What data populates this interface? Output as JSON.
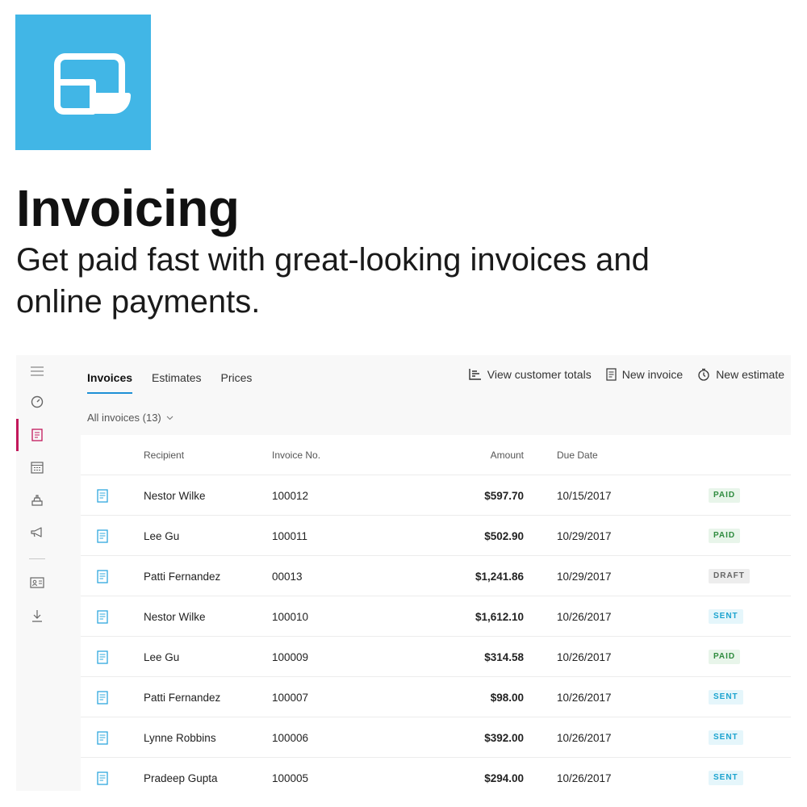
{
  "hero": {
    "title": "Invoicing",
    "subtitle": "Get paid fast with great-looking invoices and online payments."
  },
  "colors": {
    "brand_tile": "#41b6e6",
    "active_rail": "#c2185b",
    "active_tab_underline": "#1e90d6",
    "paid": "#2e8b3e",
    "sent": "#1ba3cf",
    "draft": "#666666"
  },
  "rail": {
    "items": [
      {
        "icon": "hamburger-menu-icon"
      },
      {
        "icon": "dashboard-gauge-icon"
      },
      {
        "icon": "invoice-document-icon",
        "active": true
      },
      {
        "icon": "calendar-icon"
      },
      {
        "icon": "cash-register-icon"
      },
      {
        "icon": "megaphone-icon"
      },
      {
        "icon": "contact-card-icon"
      },
      {
        "icon": "download-icon"
      }
    ]
  },
  "tabs": [
    {
      "label": "Invoices",
      "active": true
    },
    {
      "label": "Estimates",
      "active": false
    },
    {
      "label": "Prices",
      "active": false
    }
  ],
  "commands": {
    "view_totals": "View customer totals",
    "new_invoice": "New invoice",
    "new_estimate": "New estimate"
  },
  "filter": {
    "label": "All invoices (13)"
  },
  "table": {
    "headers": {
      "recipient": "Recipient",
      "number": "Invoice No.",
      "amount": "Amount",
      "due": "Due Date"
    },
    "rows": [
      {
        "recipient": "Nestor Wilke",
        "number": "100012",
        "amount": "$597.70",
        "due": "10/15/2017",
        "status": "PAID"
      },
      {
        "recipient": "Lee Gu",
        "number": "100011",
        "amount": "$502.90",
        "due": "10/29/2017",
        "status": "PAID"
      },
      {
        "recipient": "Patti Fernandez",
        "number": "00013",
        "amount": "$1,241.86",
        "due": "10/29/2017",
        "status": "DRAFT"
      },
      {
        "recipient": "Nestor Wilke",
        "number": "100010",
        "amount": "$1,612.10",
        "due": "10/26/2017",
        "status": "SENT"
      },
      {
        "recipient": "Lee Gu",
        "number": "100009",
        "amount": "$314.58",
        "due": "10/26/2017",
        "status": "PAID"
      },
      {
        "recipient": "Patti Fernandez",
        "number": "100007",
        "amount": "$98.00",
        "due": "10/26/2017",
        "status": "SENT"
      },
      {
        "recipient": "Lynne Robbins",
        "number": "100006",
        "amount": "$392.00",
        "due": "10/26/2017",
        "status": "SENT"
      },
      {
        "recipient": "Pradeep Gupta",
        "number": "100005",
        "amount": "$294.00",
        "due": "10/26/2017",
        "status": "SENT"
      }
    ]
  }
}
